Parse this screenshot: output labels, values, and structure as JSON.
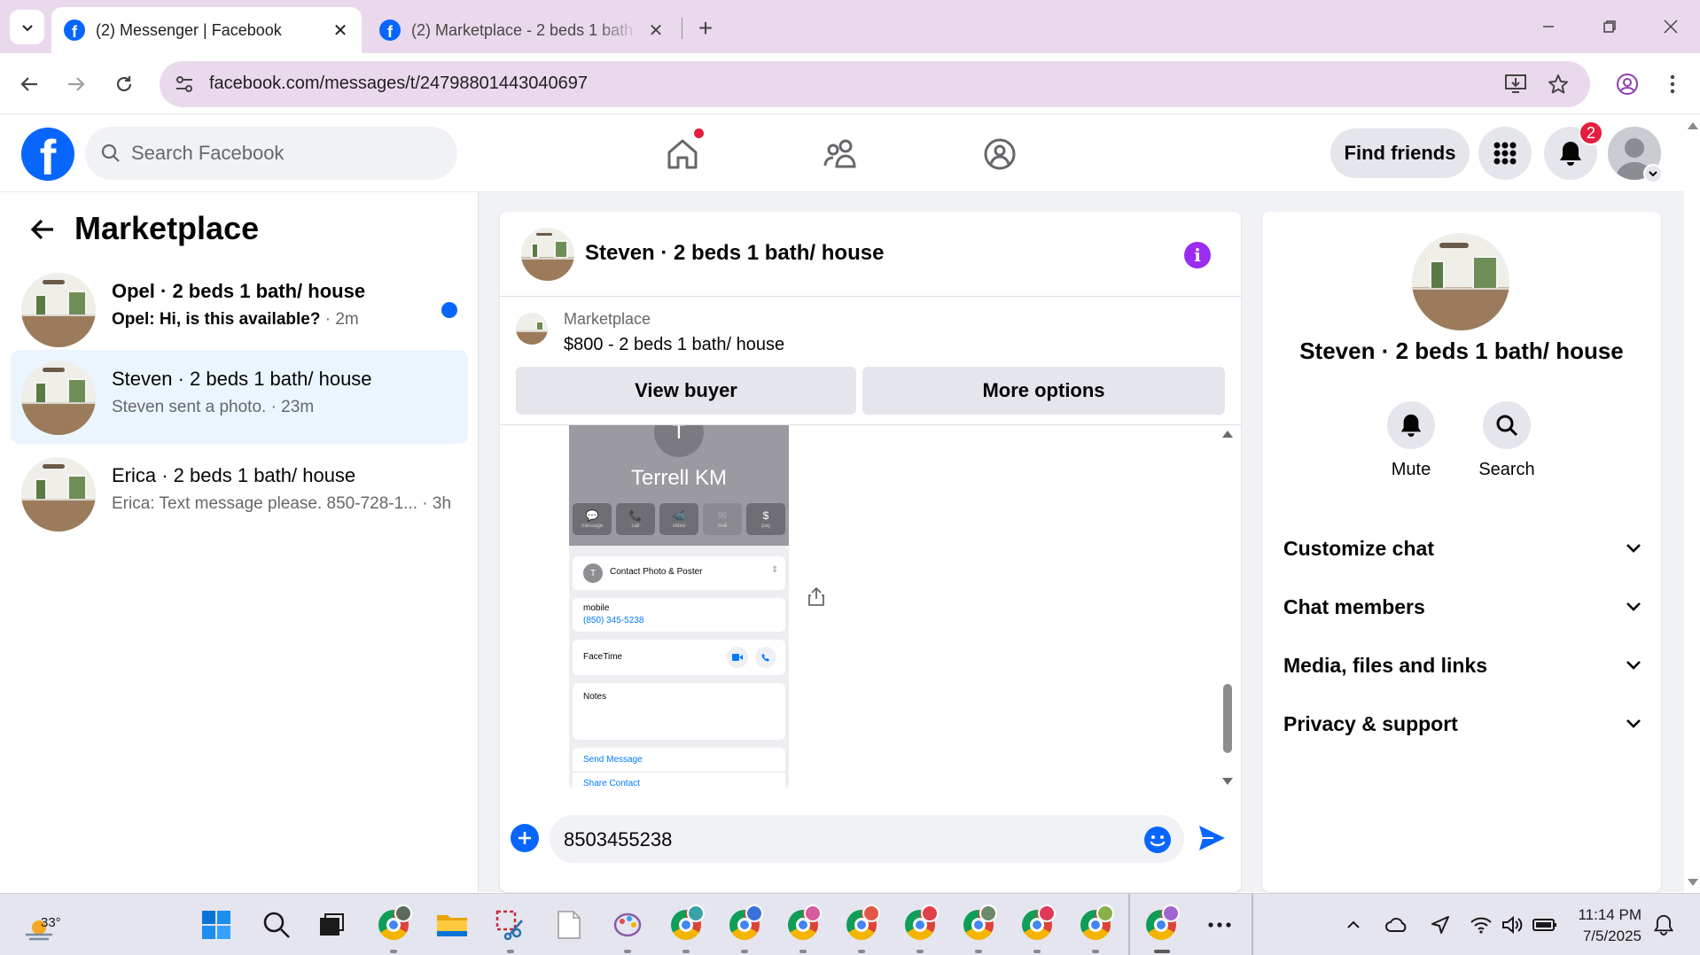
{
  "browser": {
    "tabs": [
      {
        "title": "(2) Messenger | Facebook",
        "active": true
      },
      {
        "title": "(2) Marketplace - 2 beds 1 bath",
        "active": false
      }
    ],
    "url": "facebook.com/messages/t/24798801443040697"
  },
  "header": {
    "search_placeholder": "Search Facebook",
    "find_friends_label": "Find friends",
    "notification_count": "2",
    "accent_color": "#0866ff"
  },
  "sidebar": {
    "title": "Marketplace",
    "conversations": [
      {
        "title": "Opel · 2 beds 1 bath/ house",
        "preview": "Opel: Hi, is this available?",
        "time": " · 2m",
        "unread": true
      },
      {
        "title": "Steven · 2 beds 1 bath/ house",
        "preview": "Steven sent a photo.",
        "time": " · 23m",
        "active": true
      },
      {
        "title": "Erica · 2 beds 1 bath/ house",
        "preview": "Erica: Text message please. 850-728-1...",
        "time": " · 3h"
      }
    ]
  },
  "chat": {
    "title": "Steven · 2 beds 1 bath/ house",
    "listing": {
      "source": "Marketplace",
      "price_title": "$800 - 2 beds 1 bath/ house",
      "view_buyer_label": "View buyer",
      "more_options_label": "More options"
    },
    "photo": {
      "initial": "T",
      "contact_name": "Terrell KM",
      "actions": [
        {
          "icon": "💬",
          "label": "message"
        },
        {
          "icon": "📞",
          "label": "call"
        },
        {
          "icon": "📹",
          "label": "video"
        },
        {
          "icon": "✉",
          "label": "mail"
        },
        {
          "icon": "$",
          "label": "pay"
        }
      ],
      "contact_photo_label": "Contact Photo & Poster",
      "mobile_label": "mobile",
      "mobile_number": "(850) 345-5238",
      "facetime_label": "FaceTime",
      "notes_label": "Notes",
      "send_message_label": "Send Message",
      "share_contact_label": "Share Contact"
    },
    "composer_value": "8503455238"
  },
  "details": {
    "title": "Steven · 2 beds 1 bath/ house",
    "actions": [
      {
        "label": "Mute"
      },
      {
        "label": "Search"
      }
    ],
    "sections": [
      {
        "label": "Customize chat"
      },
      {
        "label": "Chat members"
      },
      {
        "label": "Media, files and links"
      },
      {
        "label": "Privacy & support"
      }
    ]
  },
  "taskbar": {
    "weather_temp": "33°",
    "time": "11:14 PM",
    "date": "7/5/2025"
  }
}
